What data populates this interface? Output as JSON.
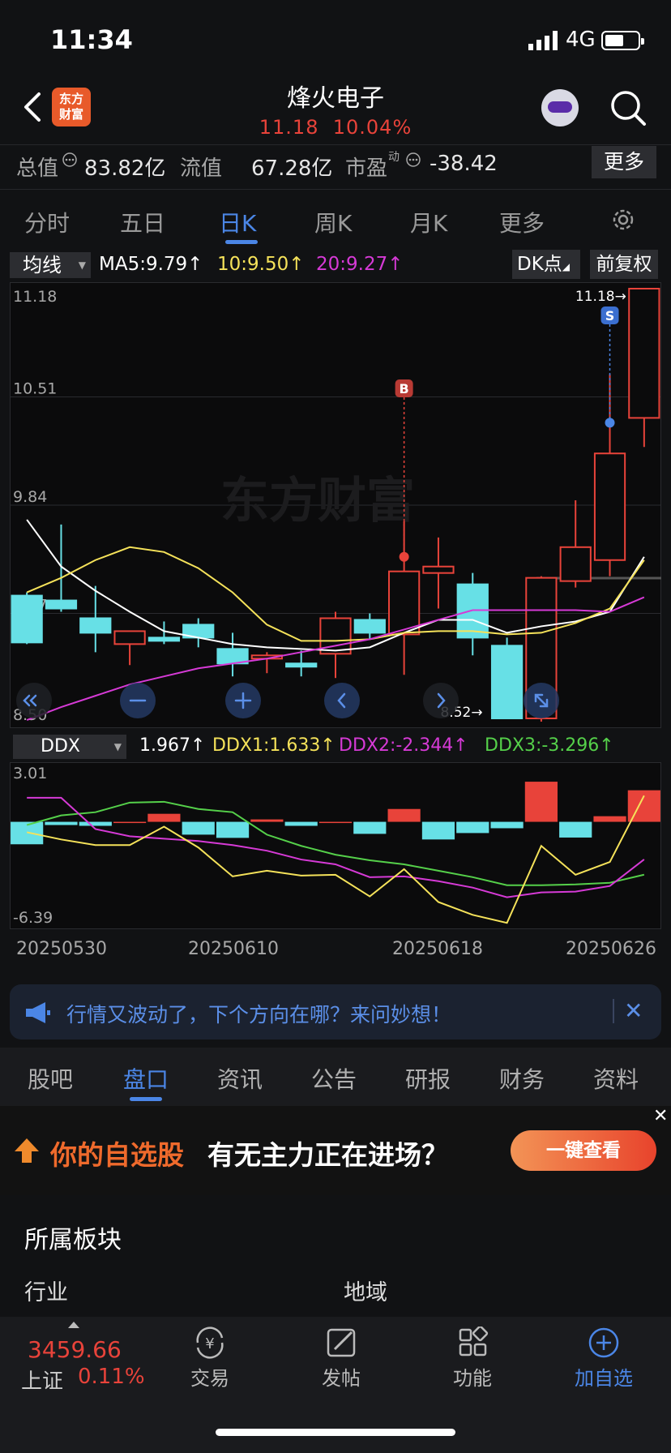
{
  "status": {
    "time": "11:34",
    "network": "4G"
  },
  "header": {
    "logo": "东方\n财富",
    "name": "烽火电子",
    "price": "11.18",
    "change_pct": "10.04%"
  },
  "info": {
    "total_label": "总值",
    "total_value": "83.82亿",
    "float_label": "流值",
    "float_value": "67.28亿",
    "pe_label": "市盈",
    "pe_sup": "动",
    "pe_value": "-38.42",
    "more": "更多"
  },
  "period_tabs": [
    "分时",
    "五日",
    "日K",
    "周K",
    "月K",
    "更多"
  ],
  "active_period": 2,
  "ma_row": {
    "select": "均线",
    "ma5": "MA5:9.79",
    "ma10": "10:9.50",
    "ma20": "20:9.27",
    "dk": "DK点",
    "fq": "前复权"
  },
  "kline_axis": [
    "11.18",
    "10.51",
    "9.84",
    "9.17",
    "8.50"
  ],
  "kline_marks": {
    "high": "11.18",
    "low": "8.52",
    "buy": "B",
    "sell": "S",
    "watermark": "东方财富"
  },
  "ddx_row": {
    "select": "DDX",
    "ddx": "1.967",
    "ddx1": "DDX1:1.633",
    "ddx2": "DDX2:-2.344",
    "ddx3": "DDX3:-3.296"
  },
  "ddx_axis": [
    "3.01",
    "-6.39"
  ],
  "dates": [
    "20250530",
    "20250610",
    "20250618",
    "20250626"
  ],
  "colors": {
    "up": "#e8433a",
    "down": "#67e0e6",
    "ma5": "#ffffff",
    "ma10": "#f5e25a",
    "ma20": "#d63ad6",
    "ddx1": "#f5e25a",
    "ddx2": "#d63ad6",
    "ddx3": "#55d04a",
    "accent": "#4b86e6"
  },
  "chart_data": [
    {
      "type": "candlestick",
      "title": "日K",
      "ylim": [
        8.5,
        11.18
      ],
      "candles": [
        {
          "o": 9.28,
          "h": 9.3,
          "l": 8.98,
          "c": 8.99
        },
        {
          "o": 9.25,
          "h": 9.72,
          "l": 9.18,
          "c": 9.2
        },
        {
          "o": 9.14,
          "h": 9.34,
          "l": 8.93,
          "c": 9.05
        },
        {
          "o": 8.98,
          "h": 9.05,
          "l": 8.85,
          "c": 9.06
        },
        {
          "o": 9.02,
          "h": 9.12,
          "l": 8.98,
          "c": 9.0
        },
        {
          "o": 9.1,
          "h": 9.14,
          "l": 8.96,
          "c": 9.02
        },
        {
          "o": 8.95,
          "h": 9.05,
          "l": 8.78,
          "c": 8.86
        },
        {
          "o": 8.89,
          "h": 8.93,
          "l": 8.8,
          "c": 8.91
        },
        {
          "o": 8.86,
          "h": 8.94,
          "l": 8.78,
          "c": 8.84
        },
        {
          "o": 8.92,
          "h": 9.18,
          "l": 8.77,
          "c": 9.14
        },
        {
          "o": 9.13,
          "h": 9.17,
          "l": 9.01,
          "c": 9.05
        },
        {
          "o": 9.04,
          "h": 9.74,
          "l": 8.79,
          "c": 9.43
        },
        {
          "o": 9.42,
          "h": 9.64,
          "l": 9.2,
          "c": 9.46
        },
        {
          "o": 9.35,
          "h": 9.42,
          "l": 8.91,
          "c": 9.02
        },
        {
          "o": 8.97,
          "h": 9.02,
          "l": 8.52,
          "c": 8.52
        },
        {
          "o": 8.52,
          "h": 9.4,
          "l": 8.5,
          "c": 9.39
        },
        {
          "o": 9.37,
          "h": 9.87,
          "l": 9.33,
          "c": 9.58
        },
        {
          "o": 9.5,
          "h": 10.65,
          "l": 9.4,
          "c": 10.16
        },
        {
          "o": 10.38,
          "h": 11.18,
          "l": 10.2,
          "c": 11.18
        }
      ],
      "ma5": [
        9.75,
        9.46,
        9.31,
        9.18,
        9.06,
        9.02,
        8.98,
        8.96,
        8.95,
        8.94,
        8.96,
        9.05,
        9.13,
        9.13,
        9.05,
        9.09,
        9.12,
        9.18,
        9.52
      ],
      "ma10": [
        9.3,
        9.39,
        9.5,
        9.58,
        9.55,
        9.45,
        9.3,
        9.1,
        9.0,
        9.0,
        9.01,
        9.05,
        9.06,
        9.06,
        9.04,
        9.05,
        9.11,
        9.2,
        9.5
      ],
      "ma20": [
        8.51,
        8.59,
        8.66,
        8.73,
        8.78,
        8.83,
        8.86,
        8.89,
        8.93,
        8.97,
        9.01,
        9.07,
        9.13,
        9.19,
        9.19,
        9.19,
        9.19,
        9.18,
        9.27
      ],
      "markers": [
        {
          "index": 11,
          "label": "B"
        },
        {
          "index": 17,
          "label": "S"
        }
      ]
    },
    {
      "type": "bar",
      "title": "DDX",
      "ylim": [
        -6.39,
        3.01
      ],
      "values": [
        -1.4,
        -0.2,
        -0.25,
        0.0,
        0.5,
        -0.8,
        -1.0,
        0.15,
        -0.25,
        0.0,
        -0.75,
        0.8,
        -1.1,
        -0.7,
        -0.4,
        2.5,
        -0.98,
        0.35,
        1.967
      ],
      "ddx1": [
        -0.65,
        -1.1,
        -1.45,
        -1.45,
        -0.3,
        -1.6,
        -3.4,
        -3.05,
        -3.35,
        -3.3,
        -4.65,
        -2.95,
        -5.0,
        -5.8,
        -6.3,
        -1.5,
        -3.3,
        -2.5,
        1.633
      ],
      "ddx2": [
        1.5,
        1.5,
        -0.45,
        -0.9,
        -1.05,
        -1.2,
        -1.45,
        -1.8,
        -2.35,
        -2.65,
        -3.45,
        -3.4,
        -3.7,
        -4.1,
        -4.7,
        -4.4,
        -4.35,
        -4.0,
        -2.344
      ],
      "ddx3": [
        -0.2,
        0.4,
        0.6,
        1.2,
        1.25,
        0.8,
        0.6,
        -0.8,
        -1.5,
        -2.05,
        -2.4,
        -2.65,
        -3.05,
        -3.45,
        -3.95,
        -3.95,
        -3.9,
        -3.8,
        -3.296
      ]
    }
  ],
  "banner": {
    "text": "行情又波动了，下个方向在哪？来问妙想！",
    "close": "✕"
  },
  "sub_tabs": [
    "股吧",
    "盘口",
    "资讯",
    "公告",
    "研报",
    "财务",
    "资料"
  ],
  "active_sub_tab": 1,
  "ad": {
    "text1": "你的自选股",
    "text2": "有无主力正在进场？",
    "button": "一键查看",
    "close": "✕"
  },
  "sector": {
    "title": "所属板块",
    "industry": "行业",
    "region": "地域"
  },
  "index": {
    "value": "3459.66",
    "name": "上证",
    "change": "0.11%"
  },
  "nav": [
    "交易",
    "发帖",
    "功能",
    "加自选"
  ]
}
